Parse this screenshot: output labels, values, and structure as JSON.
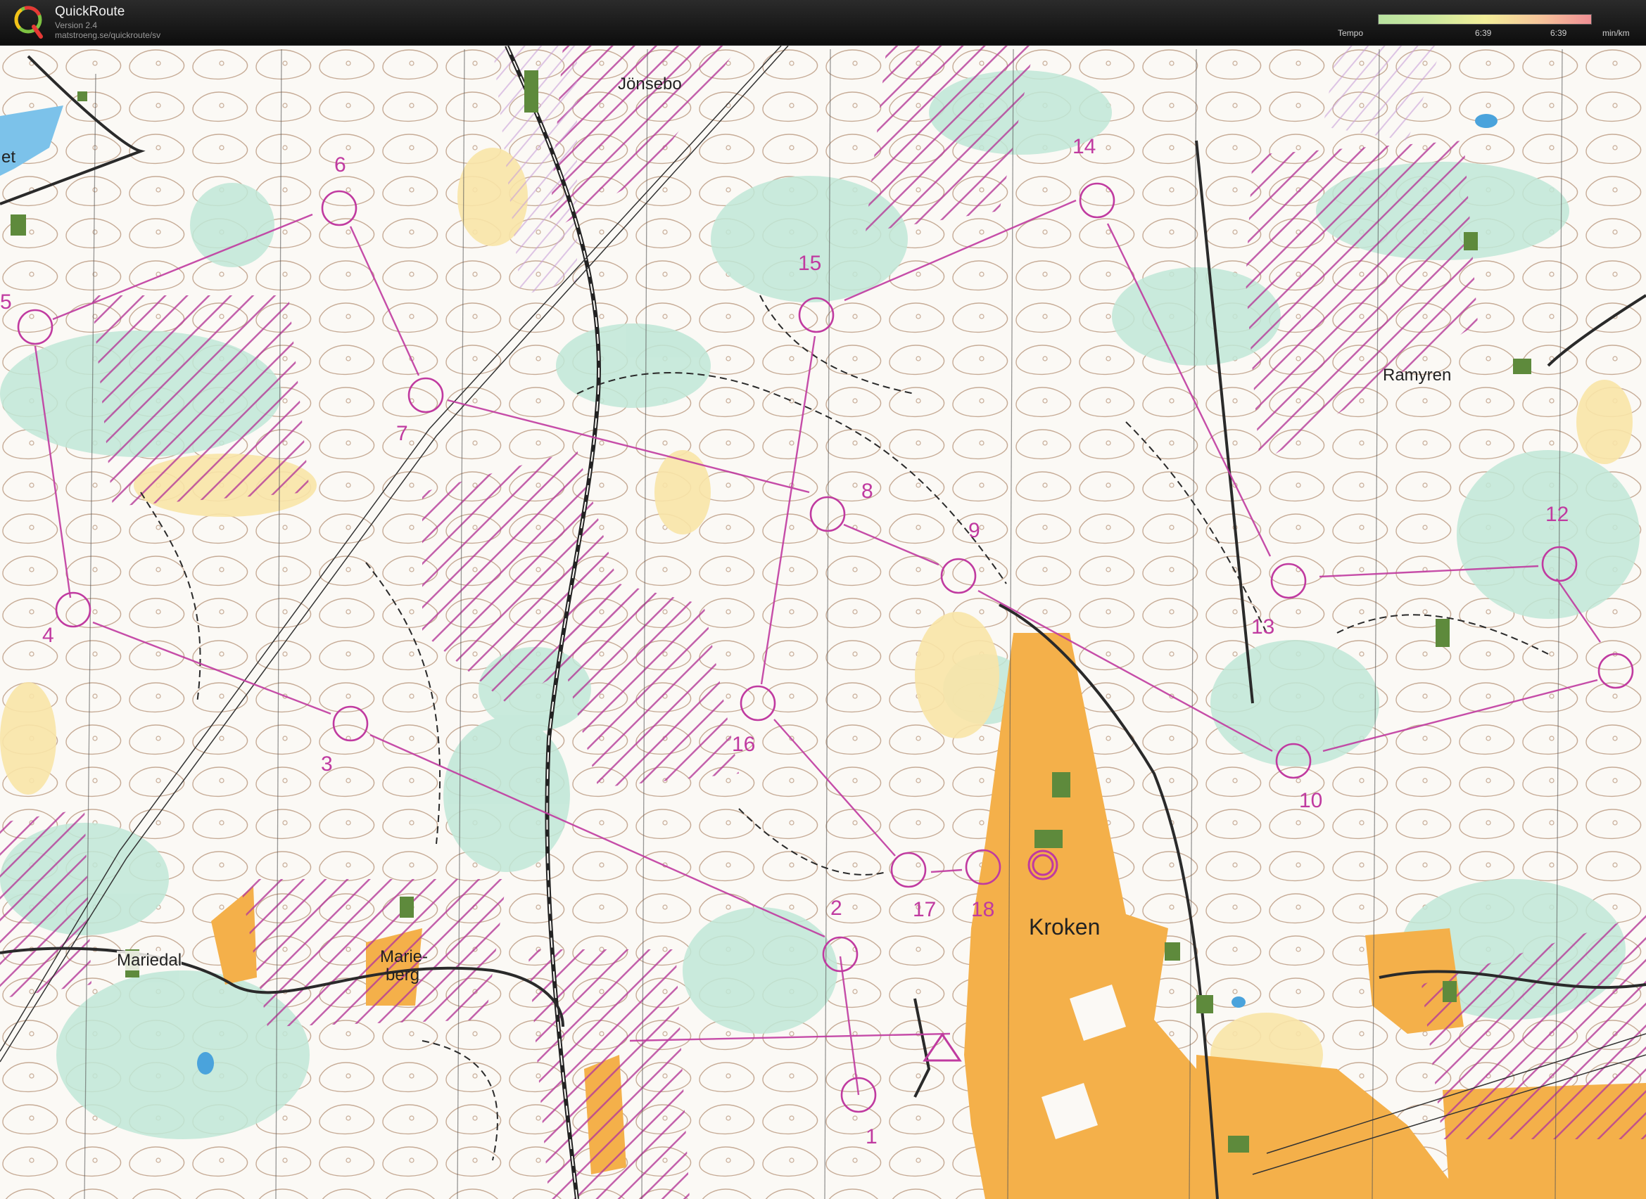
{
  "app": {
    "name": "QuickRoute",
    "version": "Version 2.4",
    "url": "matstroeng.se/quickroute/sv"
  },
  "legend": {
    "label": "Tempo",
    "tick1": "6:39",
    "tick2": "6:39",
    "unit": "min/km",
    "colors": [
      "#b8e2a0",
      "#f3ef9a",
      "#ef8f94"
    ]
  },
  "map": {
    "place_names": {
      "jonsebo": "Jönsebo",
      "ramyren": "Ramyren",
      "kroken": "Kroken",
      "mariedal": "Mariedal",
      "marieberg_1": "Marie-",
      "marieberg_2": "berg",
      "edge_text": "et"
    },
    "control_numbers": [
      "1",
      "2",
      "3",
      "4",
      "5",
      "6",
      "7",
      "8",
      "9",
      "10",
      "12",
      "13",
      "14",
      "15",
      "16",
      "17",
      "18"
    ],
    "colors": {
      "course": "#c03aa0",
      "open_land": "#f4b04a",
      "green": "#bfe7d7",
      "contour": "#8a5a3c",
      "water": "#7cc2ea"
    }
  }
}
